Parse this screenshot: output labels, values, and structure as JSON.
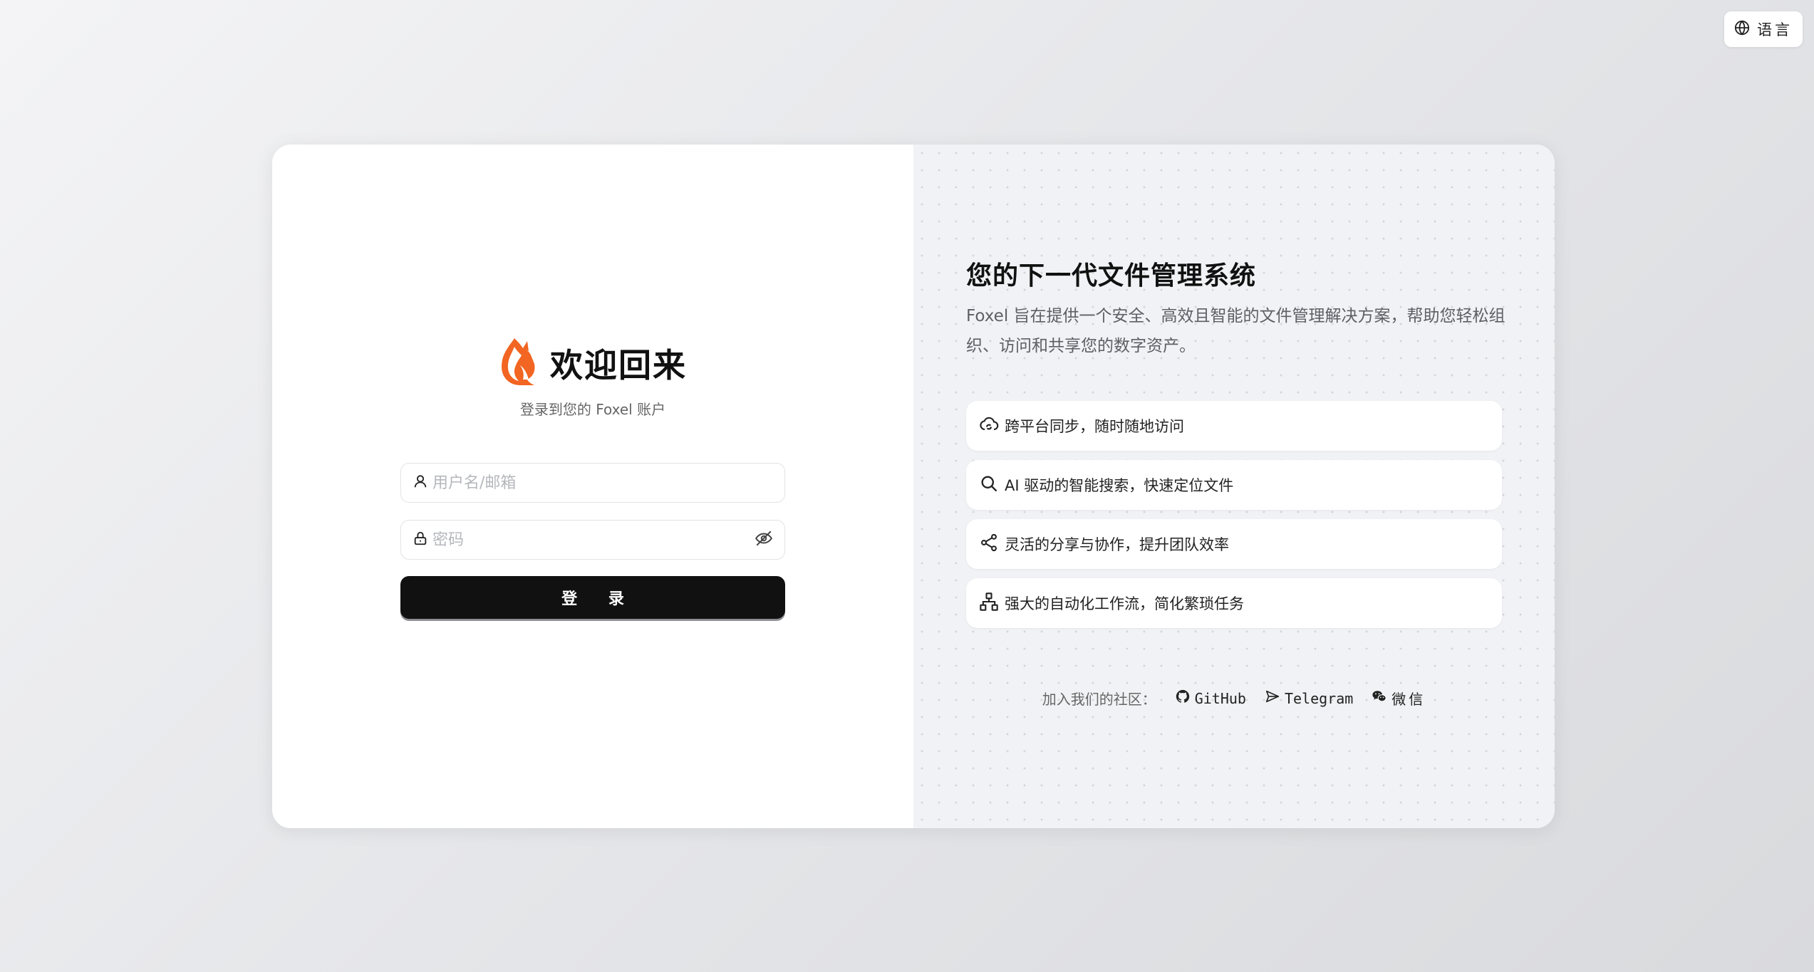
{
  "language_button": {
    "label": "语言",
    "icon": "globe-icon"
  },
  "login": {
    "title": "欢迎回来",
    "subtitle": "登录到您的 Foxel 账户",
    "username_placeholder": "用户名/邮箱",
    "password_placeholder": "密码",
    "submit_label": "登 录",
    "logo": "fox-logo",
    "brand_color": "#f26522"
  },
  "promo": {
    "title": "您的下一代文件管理系统",
    "description": "Foxel 旨在提供一个安全、高效且智能的文件管理解决方案，帮助您轻松组织、访问和共享您的数字资产。",
    "features": [
      {
        "icon": "cloud-sync-icon",
        "label": "跨平台同步，随时随地访问"
      },
      {
        "icon": "search-icon",
        "label": "AI 驱动的智能搜索，快速定位文件"
      },
      {
        "icon": "share-icon",
        "label": "灵活的分享与协作，提升团队效率"
      },
      {
        "icon": "workflow-icon",
        "label": "强大的自动化工作流，简化繁琐任务"
      }
    ],
    "community": {
      "label": "加入我们的社区：",
      "links": [
        {
          "icon": "github-icon",
          "label": "GitHub"
        },
        {
          "icon": "telegram-icon",
          "label": "Telegram"
        },
        {
          "icon": "wechat-icon",
          "label": "微信"
        }
      ]
    }
  }
}
